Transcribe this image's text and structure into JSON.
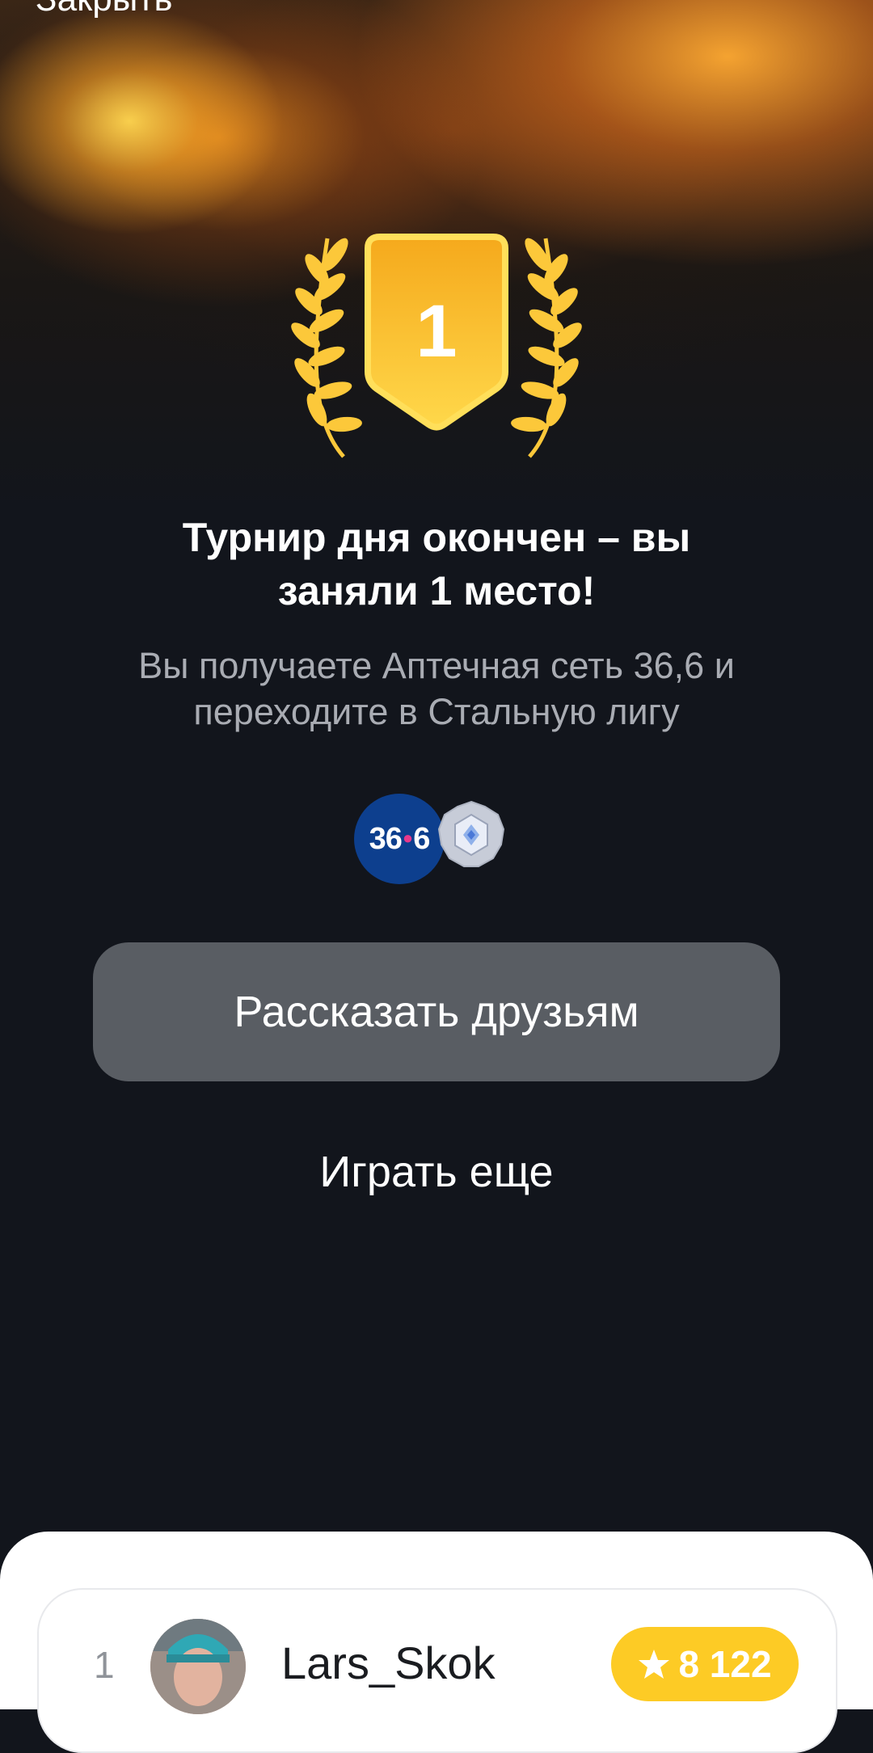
{
  "header": {
    "close_label": "Закрыть"
  },
  "trophy": {
    "place": "1"
  },
  "result": {
    "headline_line1": "Турнир дня окончен – вы",
    "headline_line2": "заняли 1 место!",
    "subtitle_line1": "Вы получаете Аптечная сеть 36,6 и",
    "subtitle_line2": "переходите в Стальную лигу"
  },
  "rewards": {
    "brand_left": "36",
    "brand_right": "6",
    "brand_color": "#0d3f8e",
    "league_icon": "steel-league-icon"
  },
  "actions": {
    "share_label": "Рассказать друзьям",
    "play_again_label": "Играть еще"
  },
  "leaderboard": {
    "rows": [
      {
        "rank": "1",
        "name": "Lars_Skok",
        "score": "8 122"
      }
    ]
  },
  "colors": {
    "background": "#12151c",
    "gold": "#fdc43a",
    "share_button": "#595d63",
    "score_pill": "#fdcb25"
  }
}
